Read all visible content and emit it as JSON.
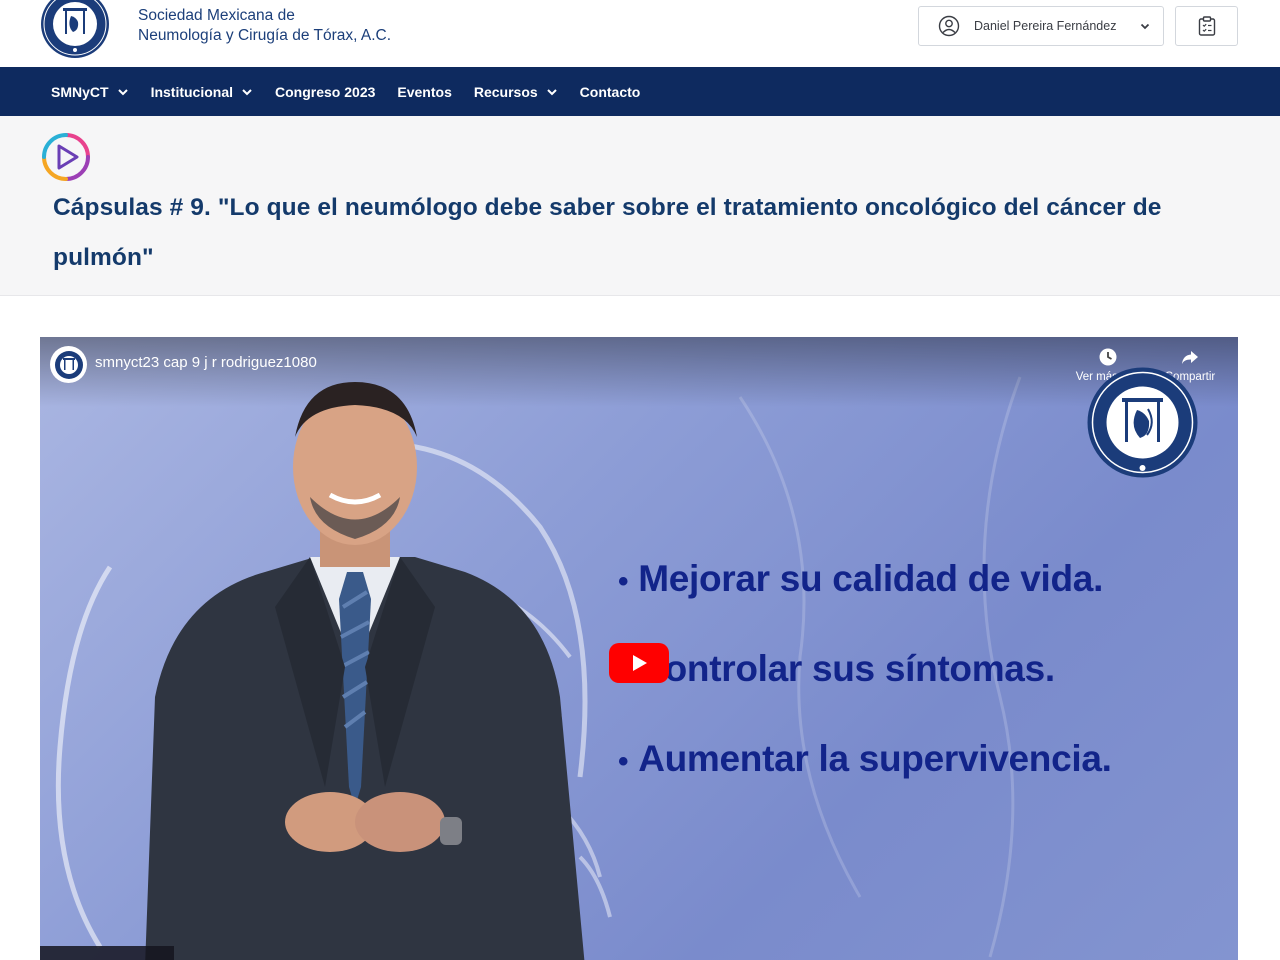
{
  "header": {
    "org_line1": "Sociedad Mexicana de",
    "org_line2": "Neumología y Cirugía de Tórax, A.C.",
    "user_name": "Daniel Pereira Fernández"
  },
  "nav": {
    "items": [
      {
        "label": "SMNyCT",
        "dropdown": true
      },
      {
        "label": "Institucional",
        "dropdown": true
      },
      {
        "label": "Congreso 2023",
        "dropdown": false
      },
      {
        "label": "Eventos",
        "dropdown": false
      },
      {
        "label": "Recursos",
        "dropdown": true
      },
      {
        "label": "Contacto",
        "dropdown": false
      }
    ]
  },
  "page": {
    "title": "Cápsulas # 9. \"Lo que el neumólogo debe saber sobre el tratamiento oncológico del cáncer de pulmón\""
  },
  "video": {
    "title": "smnyct23 cap 9 j r rodriguez1080",
    "watch_later_label": "Ver más ta...",
    "share_label": "Compartir",
    "bullets": [
      "Mejorar su calidad de vida.",
      "Controlar sus síntomas.",
      "Aumentar la supervivencia."
    ]
  },
  "colors": {
    "brand_navy": "#0e2a5f",
    "title_blue": "#143a6b",
    "slide_text": "#12248a",
    "youtube_red": "#ff0000"
  },
  "icons": [
    "user-circle-icon",
    "chevron-down-icon",
    "clipboard-icon",
    "clock-icon",
    "share-icon",
    "play-icon"
  ]
}
